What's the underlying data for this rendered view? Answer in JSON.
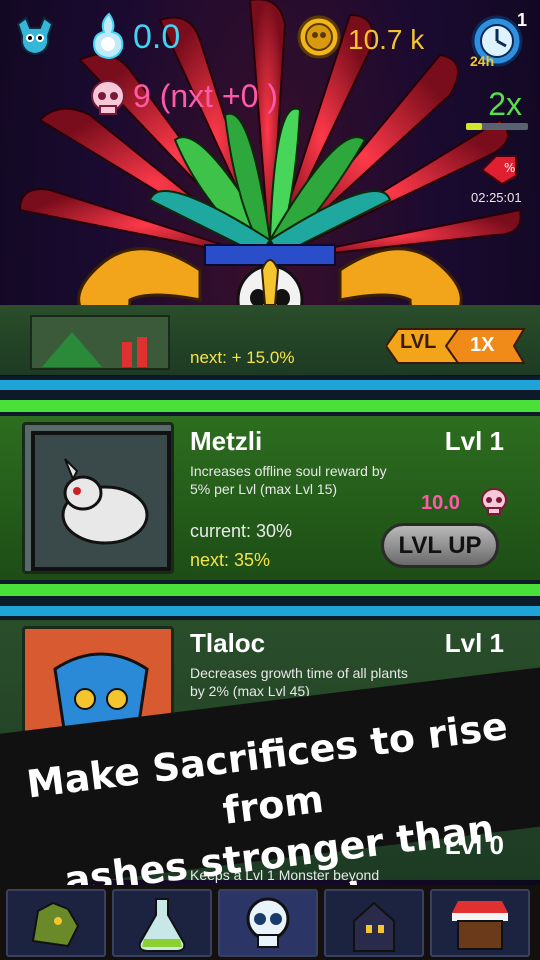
{
  "hud": {
    "souls": "0.0",
    "gold": "10.7 k",
    "skulls": "9  (nxt +0 )",
    "multiplier": "2x",
    "multiplier_progress": 0.25,
    "boost_count": "1",
    "boost_hours": "24h",
    "timer": "02:25:01"
  },
  "top_card": {
    "next": "next: + 15.0%",
    "lvl_label": "LVL",
    "mult_label": "1X"
  },
  "cards": [
    {
      "name": "Metzli",
      "level": "Lvl 1",
      "desc": "Increases offline soul reward by 5% per Lvl (max Lvl 15)",
      "current": "current: 30%",
      "next": "next: 35%",
      "cost": "10.0",
      "button": "LVL UP"
    },
    {
      "name": "Tlaloc",
      "level": "Lvl 1",
      "desc": "Decreases growth time of all plants by 2% (max Lvl 45)"
    },
    {
      "level": "Lvl 0",
      "desc": "Keeps a Lvl 1 Monster beyond"
    }
  ],
  "banner": {
    "line1": "Make Sacrifices to rise from",
    "line2": "ashes stronger than before!"
  },
  "nav": {
    "items": [
      "monster-tab",
      "lab-tab",
      "sacrifice-tab",
      "house-tab",
      "shop-tab"
    ]
  },
  "colors": {
    "souls": "#3fd3f5",
    "gold": "#f5c530",
    "skulls": "#ff5aa8",
    "multiplier": "#54e046"
  }
}
